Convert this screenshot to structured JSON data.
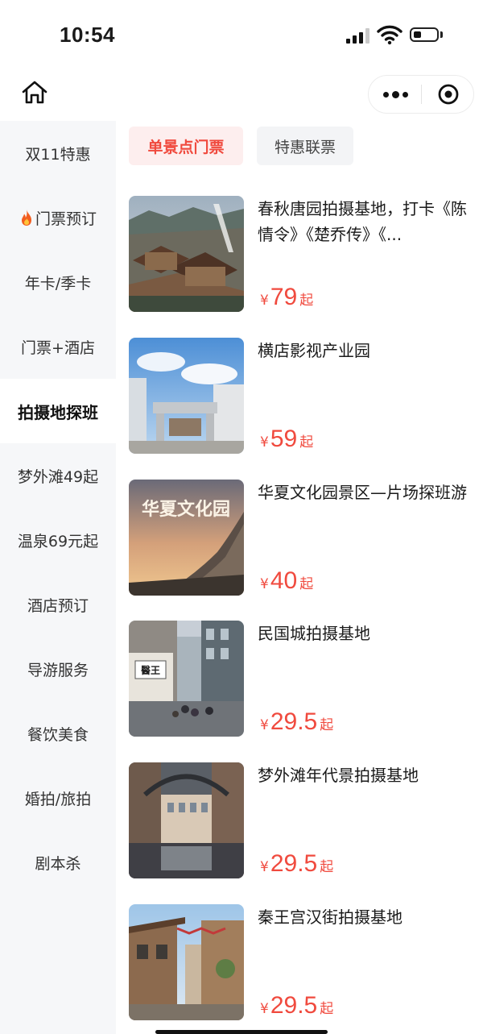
{
  "status_bar": {
    "time": "10:54"
  },
  "sidebar": {
    "items": [
      {
        "label": "双11特惠"
      },
      {
        "label": "门票预订",
        "icon": "fire-icon"
      },
      {
        "label": "年卡/季卡"
      },
      {
        "label": "门票+酒店"
      },
      {
        "label": "拍摄地探班",
        "active": true
      },
      {
        "label": "梦外滩49起"
      },
      {
        "label": "温泉69元起"
      },
      {
        "label": "酒店预订"
      },
      {
        "label": "导游服务"
      },
      {
        "label": "餐饮美食"
      },
      {
        "label": "婚拍/旅拍"
      },
      {
        "label": "剧本杀"
      }
    ]
  },
  "tabs": [
    {
      "label": "单景点门票",
      "active": true
    },
    {
      "label": "特惠联票",
      "active": false
    }
  ],
  "products": [
    {
      "name": "春秋唐园拍摄基地，打卡《陈情令》《楚乔传》《...",
      "currency": "¥",
      "price": "79",
      "suffix": "起"
    },
    {
      "name": "横店影视产业园",
      "currency": "¥",
      "price": "59",
      "suffix": "起"
    },
    {
      "name": "华夏文化园景区—片场探班游",
      "currency": "¥",
      "price": "40",
      "suffix": "起",
      "thumb_text": "华夏文化园"
    },
    {
      "name": "民国城拍摄基地",
      "currency": "¥",
      "price": "29.5",
      "suffix": "起",
      "thumb_text": "醫王"
    },
    {
      "name": "梦外滩年代景拍摄基地",
      "currency": "¥",
      "price": "29.5",
      "suffix": "起"
    },
    {
      "name": "秦王宫汉街拍摄基地",
      "currency": "¥",
      "price": "29.5",
      "suffix": "起"
    }
  ],
  "colors": {
    "accent": "#f04a3e",
    "sidebar_bg": "#f6f7f9",
    "active_tab_bg": "#fdeeee"
  }
}
